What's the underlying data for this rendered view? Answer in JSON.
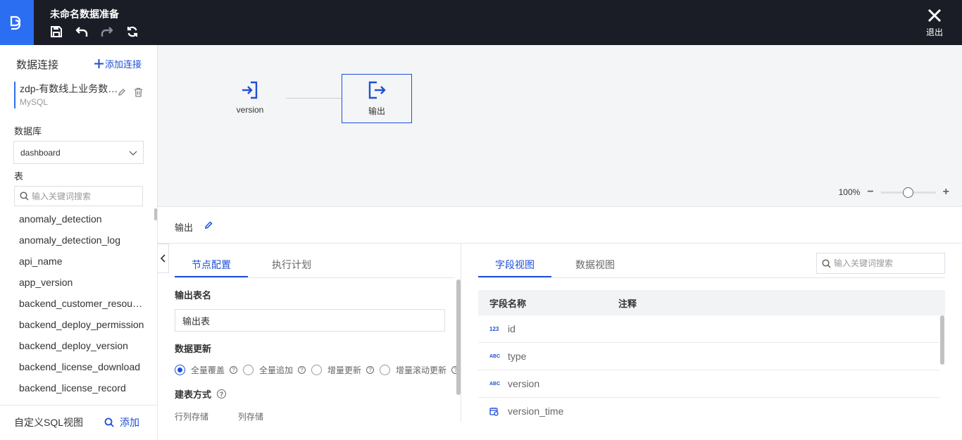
{
  "header": {
    "title": "未命名数据准备",
    "exit_label": "退出"
  },
  "sidebar": {
    "title": "数据连接",
    "add_connection": "添加连接",
    "connection": {
      "name": "zdp-有数线上业务数据库",
      "type": "MySQL"
    },
    "database_label": "数据库",
    "database_value": "dashboard",
    "table_label": "表",
    "search_placeholder": "输入关键词搜索",
    "tables": [
      "anomaly_detection",
      "anomaly_detection_log",
      "api_name",
      "app_version",
      "backend_customer_resource",
      "backend_deploy_permission",
      "backend_deploy_version",
      "backend_license_download",
      "backend_license_record"
    ],
    "footer_label": "自定义SQL视图",
    "footer_add": "添加"
  },
  "canvas": {
    "nodes": [
      {
        "label": "version"
      },
      {
        "label": "输出"
      }
    ],
    "zoom_level": "100%",
    "zoom_fraction": 0.5
  },
  "panel": {
    "title": "输出",
    "left_tabs": [
      "节点配置",
      "执行计划"
    ],
    "output_table_label": "输出表名",
    "output_table_value": "输出表",
    "update_label": "数据更新",
    "update_options": [
      "全量覆盖",
      "全量追加",
      "增量更新",
      "增量滚动更新"
    ],
    "update_selected": "全量覆盖",
    "create_label": "建表方式",
    "storage_options": [
      "行列存储",
      "列存储"
    ],
    "right_tabs": [
      "字段视图",
      "数据视图"
    ],
    "right_search_placeholder": "输入关键词搜索",
    "field_headers": [
      "字段名称",
      "注释"
    ],
    "fields": [
      {
        "type": "123",
        "name": "id"
      },
      {
        "type": "ABC",
        "name": "type"
      },
      {
        "type": "ABC",
        "name": "version"
      },
      {
        "type": "date",
        "name": "version_time"
      }
    ]
  }
}
